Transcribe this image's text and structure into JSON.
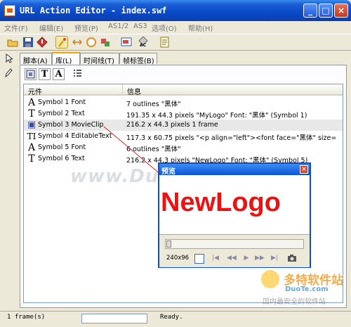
{
  "window": {
    "title": "URL Action Editor - index.swf",
    "buttons": [
      "_",
      "□",
      "×"
    ]
  },
  "menu": [
    "文件(F)",
    "编辑(E)",
    "预览(P)",
    "AS1/2",
    "AS3",
    "选项(O)",
    "帮助(H)"
  ],
  "toolbar_icons": [
    "open-icon",
    "save-icon",
    "diamond-icon",
    "actionscript-icon",
    "swap-icon",
    "circle-icon",
    "puzzle-icon",
    "preview-icon",
    "ac-icon",
    "notes-icon"
  ],
  "toolbar_labels": {
    "ac": "AC"
  },
  "tabs": [
    "脚本(A)",
    "库(L)",
    "时间线(T)",
    "帧标签(B)"
  ],
  "active_tab": "库(L)",
  "subtoolbar": {
    "text_t": "T",
    "text_a": "A"
  },
  "columns": [
    "元件",
    "信息"
  ],
  "rows": [
    {
      "icon": "A",
      "name": "Symbol 1 Font",
      "info": "7 outlines \"黑体\""
    },
    {
      "icon": "T",
      "name": "Symbol 2 Text",
      "info": "191.35 x 44.3 pixels  \"MyLogo\" Font: \"黑体\" (Symbol 1)"
    },
    {
      "icon": "▣",
      "name": "Symbol 3 MovieClip",
      "info": "216.2 x 44.3 pixels  1 frame"
    },
    {
      "icon": "TI",
      "name": "Symbol 4 EditableText",
      "info": "117.3 x 60.75 pixels  \"<p align=\"left\"><font face=\"黑体\" size=\"50\" c..."
    },
    {
      "icon": "A",
      "name": "Symbol 5 Font",
      "info": "6 outlines \"黑体\""
    },
    {
      "icon": "T",
      "name": "Symbol 6 Text",
      "info": "216.2 x 44.3 pixels  \"NewLogo\" Font: \"黑体\" (Symbol 5)"
    }
  ],
  "watermark": "www.DuoTe.com",
  "preview": {
    "title": "预览",
    "logo_text": "NewLogo",
    "size_label": "240x96",
    "slider_position": 0.0
  },
  "status": {
    "frames": "1 frame(s)",
    "state": "Ready."
  },
  "corner_logo": {
    "brand": "多特软件站",
    "domain": "DuoTe.com",
    "slogan": "国内最安全的软件站"
  },
  "colors": {
    "titlebar": "#0a49c8",
    "logo_red": "#ee1111",
    "arrow": "#d22"
  }
}
